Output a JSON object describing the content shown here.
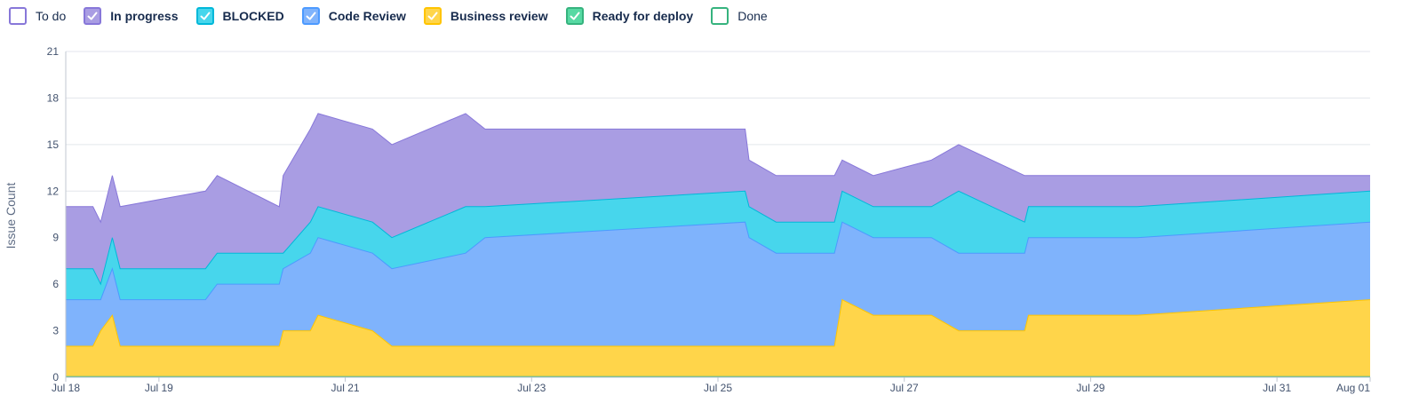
{
  "chart_data": {
    "type": "area",
    "ylabel": "Issue Count",
    "ylim": [
      0,
      21
    ],
    "yticks": [
      0,
      3,
      6,
      9,
      12,
      15,
      18,
      21
    ],
    "xlim": [
      "2024-07-18 00:00",
      "2024-08-01 00:00"
    ],
    "xticks": [
      {
        "date": "2024-07-18 00:00",
        "label": "Jul 18"
      },
      {
        "date": "2024-07-19 00:00",
        "label": "Jul 19"
      },
      {
        "date": "2024-07-21 00:00",
        "label": "Jul 21"
      },
      {
        "date": "2024-07-23 00:00",
        "label": "Jul 23"
      },
      {
        "date": "2024-07-25 00:00",
        "label": "Jul 25"
      },
      {
        "date": "2024-07-27 00:00",
        "label": "Jul 27"
      },
      {
        "date": "2024-07-29 00:00",
        "label": "Jul 29"
      },
      {
        "date": "2024-07-31 00:00",
        "label": "Jul 31"
      },
      {
        "date": "2024-08-01 00:00",
        "label": "Aug 01"
      }
    ],
    "grid": true,
    "legend_position": "top-left",
    "stacked": true,
    "series": [
      {
        "name": "To do",
        "color": "#8777d9",
        "fill": "#ffffff",
        "checked": false,
        "bold": false,
        "values": []
      },
      {
        "name": "In progress",
        "color": "#8777d9",
        "fill": "#a99de3",
        "checked": true,
        "bold": true,
        "values": [
          [
            "2024-07-18 00:00",
            4
          ],
          [
            "2024-07-18 07:00",
            4
          ],
          [
            "2024-07-18 09:00",
            4
          ],
          [
            "2024-07-18 12:00",
            4
          ],
          [
            "2024-07-18 14:00",
            4
          ],
          [
            "2024-07-19 12:00",
            5
          ],
          [
            "2024-07-19 15:00",
            5
          ],
          [
            "2024-07-20 07:00",
            3
          ],
          [
            "2024-07-20 08:00",
            5
          ],
          [
            "2024-07-20 15:00",
            6
          ],
          [
            "2024-07-20 17:00",
            6
          ],
          [
            "2024-07-21 07:00",
            6
          ],
          [
            "2024-07-21 12:00",
            6
          ],
          [
            "2024-07-22 07:00",
            6
          ],
          [
            "2024-07-22 12:00",
            5
          ],
          [
            "2024-07-25 07:00",
            4
          ],
          [
            "2024-07-25 08:00",
            3
          ],
          [
            "2024-07-25 15:00",
            3
          ],
          [
            "2024-07-26 06:00",
            3
          ],
          [
            "2024-07-26 08:00",
            2
          ],
          [
            "2024-07-26 16:00",
            2
          ],
          [
            "2024-07-27 07:00",
            3
          ],
          [
            "2024-07-27 14:00",
            3
          ],
          [
            "2024-07-28 07:00",
            3
          ],
          [
            "2024-07-28 08:00",
            2
          ],
          [
            "2024-07-29 12:00",
            2
          ],
          [
            "2024-08-01 00:00",
            1
          ]
        ]
      },
      {
        "name": "BLOCKED",
        "color": "#00b8d9",
        "fill": "#47d6ec",
        "checked": true,
        "bold": true,
        "values": [
          [
            "2024-07-18 00:00",
            2
          ],
          [
            "2024-07-18 07:00",
            2
          ],
          [
            "2024-07-18 09:00",
            1
          ],
          [
            "2024-07-18 12:00",
            2
          ],
          [
            "2024-07-18 14:00",
            2
          ],
          [
            "2024-07-19 12:00",
            2
          ],
          [
            "2024-07-19 15:00",
            2
          ],
          [
            "2024-07-20 07:00",
            2
          ],
          [
            "2024-07-20 08:00",
            1
          ],
          [
            "2024-07-20 15:00",
            2
          ],
          [
            "2024-07-20 17:00",
            2
          ],
          [
            "2024-07-21 07:00",
            2
          ],
          [
            "2024-07-21 12:00",
            2
          ],
          [
            "2024-07-22 07:00",
            3
          ],
          [
            "2024-07-22 12:00",
            2
          ],
          [
            "2024-07-25 07:00",
            2
          ],
          [
            "2024-07-25 08:00",
            2
          ],
          [
            "2024-07-25 15:00",
            2
          ],
          [
            "2024-07-26 06:00",
            2
          ],
          [
            "2024-07-26 08:00",
            2
          ],
          [
            "2024-07-26 16:00",
            2
          ],
          [
            "2024-07-27 07:00",
            2
          ],
          [
            "2024-07-27 14:00",
            4
          ],
          [
            "2024-07-28 07:00",
            2
          ],
          [
            "2024-07-28 08:00",
            2
          ],
          [
            "2024-07-29 12:00",
            2
          ],
          [
            "2024-08-01 00:00",
            2
          ]
        ]
      },
      {
        "name": "Code Review",
        "color": "#4c9aff",
        "fill": "#7fb3fc",
        "checked": true,
        "bold": true,
        "values": [
          [
            "2024-07-18 00:00",
            3
          ],
          [
            "2024-07-18 07:00",
            3
          ],
          [
            "2024-07-18 09:00",
            2
          ],
          [
            "2024-07-18 12:00",
            3
          ],
          [
            "2024-07-18 14:00",
            3
          ],
          [
            "2024-07-19 12:00",
            3
          ],
          [
            "2024-07-19 15:00",
            4
          ],
          [
            "2024-07-20 07:00",
            4
          ],
          [
            "2024-07-20 08:00",
            4
          ],
          [
            "2024-07-20 15:00",
            5
          ],
          [
            "2024-07-20 17:00",
            5
          ],
          [
            "2024-07-21 07:00",
            5
          ],
          [
            "2024-07-21 12:00",
            5
          ],
          [
            "2024-07-22 07:00",
            6
          ],
          [
            "2024-07-22 12:00",
            7
          ],
          [
            "2024-07-25 07:00",
            8
          ],
          [
            "2024-07-25 08:00",
            7
          ],
          [
            "2024-07-25 15:00",
            6
          ],
          [
            "2024-07-26 06:00",
            6
          ],
          [
            "2024-07-26 08:00",
            5
          ],
          [
            "2024-07-26 16:00",
            5
          ],
          [
            "2024-07-27 07:00",
            5
          ],
          [
            "2024-07-27 14:00",
            5
          ],
          [
            "2024-07-28 07:00",
            5
          ],
          [
            "2024-07-28 08:00",
            5
          ],
          [
            "2024-07-29 12:00",
            5
          ],
          [
            "2024-08-01 00:00",
            5
          ]
        ]
      },
      {
        "name": "Business review",
        "color": "#ffc400",
        "fill": "#ffd54a",
        "checked": true,
        "bold": true,
        "values": [
          [
            "2024-07-18 00:00",
            2
          ],
          [
            "2024-07-18 07:00",
            2
          ],
          [
            "2024-07-18 09:00",
            3
          ],
          [
            "2024-07-18 12:00",
            4
          ],
          [
            "2024-07-18 14:00",
            2
          ],
          [
            "2024-07-19 12:00",
            2
          ],
          [
            "2024-07-19 15:00",
            2
          ],
          [
            "2024-07-20 07:00",
            2
          ],
          [
            "2024-07-20 08:00",
            3
          ],
          [
            "2024-07-20 15:00",
            3
          ],
          [
            "2024-07-20 17:00",
            4
          ],
          [
            "2024-07-21 07:00",
            3
          ],
          [
            "2024-07-21 12:00",
            2
          ],
          [
            "2024-07-22 07:00",
            2
          ],
          [
            "2024-07-22 12:00",
            2
          ],
          [
            "2024-07-25 07:00",
            2
          ],
          [
            "2024-07-25 08:00",
            2
          ],
          [
            "2024-07-25 15:00",
            2
          ],
          [
            "2024-07-26 06:00",
            2
          ],
          [
            "2024-07-26 08:00",
            5
          ],
          [
            "2024-07-26 16:00",
            4
          ],
          [
            "2024-07-27 07:00",
            4
          ],
          [
            "2024-07-27 14:00",
            3
          ],
          [
            "2024-07-28 07:00",
            3
          ],
          [
            "2024-07-28 08:00",
            4
          ],
          [
            "2024-07-29 12:00",
            4
          ],
          [
            "2024-08-01 00:00",
            5
          ]
        ]
      },
      {
        "name": "Ready for deploy",
        "color": "#36b37e",
        "fill": "#57d9a3",
        "checked": true,
        "bold": true,
        "values": []
      },
      {
        "name": "Done",
        "color": "#36b37e",
        "fill": "#ffffff",
        "checked": false,
        "bold": false,
        "values": []
      }
    ]
  }
}
